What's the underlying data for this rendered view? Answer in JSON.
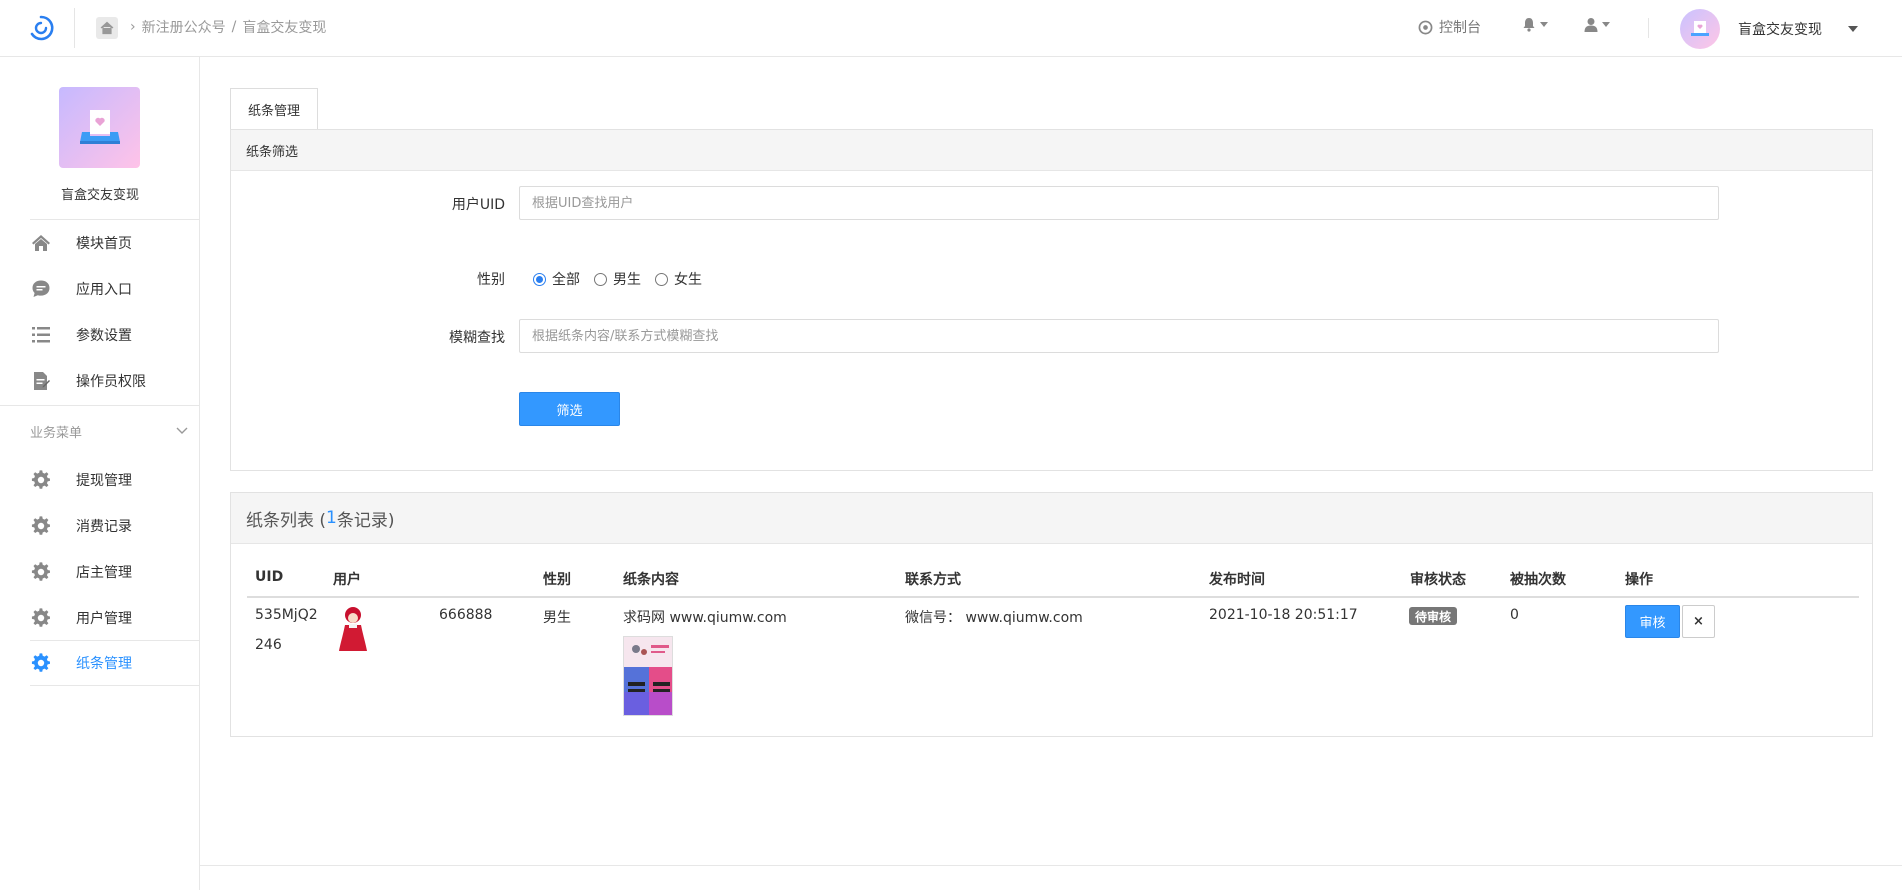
{
  "header": {
    "breadcrumb": [
      "新注册公众号",
      "盲盒交友变现"
    ],
    "console_label": "控制台",
    "user_name": "盲盒交友变现"
  },
  "sidebar": {
    "app_name": "盲盒交友变现",
    "items": [
      {
        "label": "模块首页",
        "icon": "home-icon"
      },
      {
        "label": "应用入口",
        "icon": "chat-bubble-icon"
      },
      {
        "label": "参数设置",
        "icon": "list-icon"
      },
      {
        "label": "操作员权限",
        "icon": "document-edit-icon"
      }
    ],
    "group_title": "业务菜单",
    "business_items": [
      {
        "label": "提现管理",
        "icon": "gear-icon",
        "active": false
      },
      {
        "label": "消费记录",
        "icon": "gear-icon",
        "active": false
      },
      {
        "label": "店主管理",
        "icon": "gear-icon",
        "active": false
      },
      {
        "label": "用户管理",
        "icon": "gear-icon",
        "active": false
      },
      {
        "label": "纸条管理",
        "icon": "gear-icon",
        "active": true
      }
    ]
  },
  "tab": {
    "label": "纸条管理"
  },
  "filter": {
    "title": "纸条筛选",
    "uid_label": "用户UID",
    "uid_placeholder": "根据UID查找用户",
    "uid_value": "",
    "gender_label": "性别",
    "gender_options": [
      "全部",
      "男生",
      "女生"
    ],
    "gender_selected": "全部",
    "fuzzy_label": "模糊查找",
    "fuzzy_placeholder": "根据纸条内容/联系方式模糊查找",
    "fuzzy_value": "",
    "submit_label": "筛选"
  },
  "list": {
    "title_prefix": "纸条列表 (",
    "count": "1",
    "title_suffix": "条记录)",
    "columns": [
      "UID",
      "用户",
      "性别",
      "纸条内容",
      "联系方式",
      "发布时间",
      "审核状态",
      "被抽次数",
      "操作"
    ],
    "rows": [
      {
        "uid_line1": "535MjQ2",
        "uid_line2": "246",
        "user_name": "666888",
        "gender": "男生",
        "content": "求码网 www.qiumw.com",
        "contact": "微信号： www.qiumw.com",
        "time": "2021-10-18 20:51:17",
        "status": "待审核",
        "draw_count": "0",
        "review_label": "审核",
        "delete_label": "×"
      }
    ]
  },
  "colors": {
    "accent": "#3398ff",
    "active_nav": "#2a91ff",
    "status_badge": "#777777"
  }
}
